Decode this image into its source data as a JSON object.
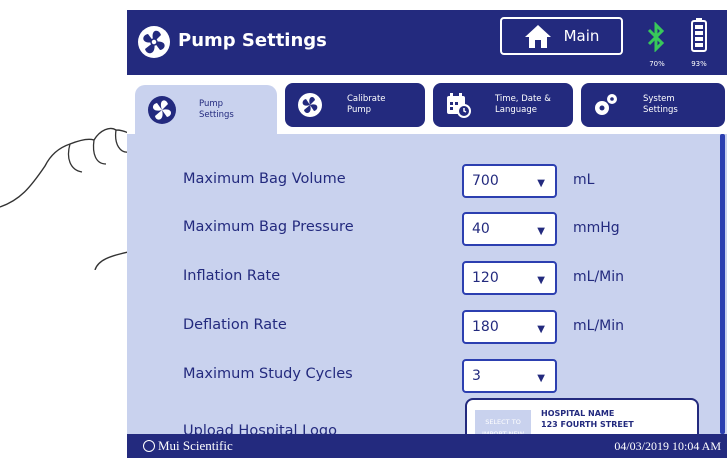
{
  "header": {
    "title": "Pump Settings",
    "main_label": "Main",
    "bluetooth_pct": "70%",
    "battery_pct": "93%"
  },
  "tabs": [
    {
      "label_line1": "Pump",
      "label_line2": "Settings",
      "icon": "fan-icon",
      "active": true
    },
    {
      "label_line1": "Calibrate",
      "label_line2": "Pump",
      "icon": "fan-gear-icon",
      "active": false
    },
    {
      "label_line1": "Time, Date &",
      "label_line2": "Language",
      "icon": "calendar-clock-icon",
      "active": false
    },
    {
      "label_line1": "System",
      "label_line2": "Settings",
      "icon": "gears-icon",
      "active": false
    }
  ],
  "settings": [
    {
      "label": "Maximum Bag Volume",
      "value": "700",
      "unit": "mL"
    },
    {
      "label": "Maximum Bag Pressure",
      "value": "40",
      "unit": "mmHg"
    },
    {
      "label": "Inflation Rate",
      "value": "120",
      "unit": "mL/Min"
    },
    {
      "label": "Deflation Rate",
      "value": "180",
      "unit": "mL/Min"
    },
    {
      "label": "Maximum Study Cycles",
      "value": "3",
      "unit": ""
    }
  ],
  "logo": {
    "label": "Upload Hospital Logo",
    "select_text": "SELECT TO IMPORT NEW",
    "line1": "HOSPITAL NAME",
    "line2": "123 FOURTH STREET"
  },
  "footer": {
    "brand": "Mui Scientific",
    "datetime": "04/03/2019 10:04 AM"
  },
  "colors": {
    "primary": "#232a7e",
    "content_bg": "#c9d2ee",
    "bluetooth": "#38c85a",
    "border_accent": "#2c3fb0"
  }
}
